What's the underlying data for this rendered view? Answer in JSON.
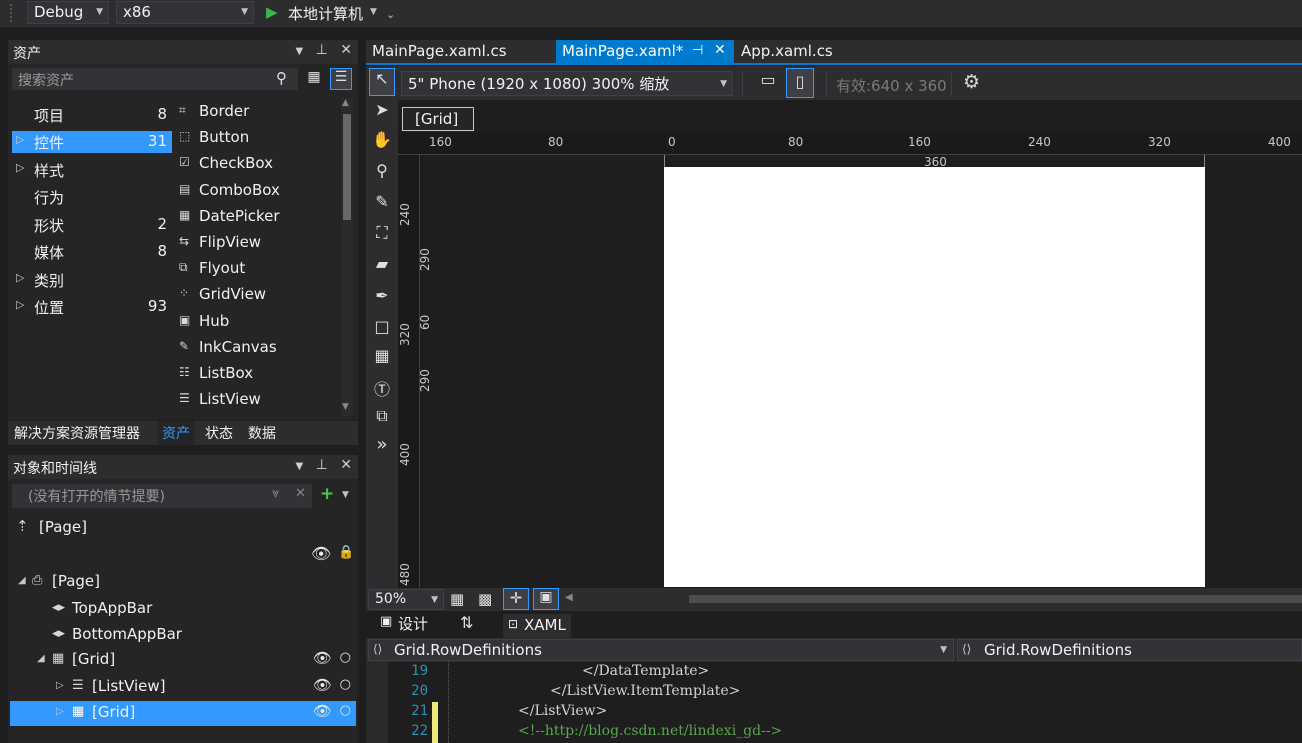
{
  "toolbar": {
    "config": "Debug",
    "platform": "x86",
    "run_target": "本地计算机"
  },
  "assets_panel": {
    "title": "资产",
    "search_placeholder": "搜索资产",
    "categories": [
      {
        "label": "项目",
        "count": "8",
        "expandable": false
      },
      {
        "label": "控件",
        "count": "31",
        "expandable": true
      },
      {
        "label": "样式",
        "count": "",
        "expandable": true
      },
      {
        "label": "行为",
        "count": "",
        "expandable": false
      },
      {
        "label": "形状",
        "count": "2",
        "expandable": false
      },
      {
        "label": "媒体",
        "count": "8",
        "expandable": false
      },
      {
        "label": "类别",
        "count": "",
        "expandable": true
      },
      {
        "label": "位置",
        "count": "93",
        "expandable": true
      }
    ],
    "controls": [
      {
        "label": "Border",
        "icon": "border-icon"
      },
      {
        "label": "Button",
        "icon": "button-icon"
      },
      {
        "label": "CheckBox",
        "icon": "checkbox-icon"
      },
      {
        "label": "ComboBox",
        "icon": "combobox-icon"
      },
      {
        "label": "DatePicker",
        "icon": "datepicker-icon"
      },
      {
        "label": "FlipView",
        "icon": "flipview-icon"
      },
      {
        "label": "Flyout",
        "icon": "flyout-icon"
      },
      {
        "label": "GridView",
        "icon": "gridview-icon"
      },
      {
        "label": "Hub",
        "icon": "hub-icon"
      },
      {
        "label": "InkCanvas",
        "icon": "inkcanvas-icon"
      },
      {
        "label": "ListBox",
        "icon": "listbox-icon"
      },
      {
        "label": "ListView",
        "icon": "listview-icon"
      }
    ],
    "bottom_tabs": [
      "解决方案资源管理器",
      "资产",
      "状态",
      "数据"
    ]
  },
  "objects_panel": {
    "title": "对象和时间线",
    "storyboard_placeholder": "(没有打开的情节提要)",
    "scope": "[Page]",
    "tree": [
      {
        "label": "[Page]"
      },
      {
        "label": "TopAppBar"
      },
      {
        "label": "BottomAppBar"
      },
      {
        "label": "[Grid]"
      },
      {
        "label": "[ListView]"
      },
      {
        "label": "[Grid]"
      }
    ]
  },
  "doc_tabs": [
    {
      "label": "MainPage.xaml.cs",
      "active": false
    },
    {
      "label": "MainPage.xaml*",
      "active": true
    },
    {
      "label": "App.xaml.cs",
      "active": false
    }
  ],
  "designer": {
    "device": "5\" Phone (1920 x 1080) 300% 缩放",
    "effective": "有效:640 x 360",
    "breadcrumb": "[Grid]",
    "zoom": "50%",
    "ruler_h": [
      "160",
      "80",
      "0",
      "80",
      "160",
      "240",
      "320",
      "400"
    ],
    "ruler_h_width": "360",
    "ruler_v": [
      "240",
      "290",
      "320",
      "60",
      "290",
      "400",
      "480"
    ],
    "view_tabs": {
      "design": "设计",
      "xaml": "XAML"
    }
  },
  "code_nav": {
    "left": "Grid.RowDefinitions",
    "right": "Grid.RowDefinitions"
  },
  "code_lines": [
    {
      "num": "19",
      "text": "</DataTemplate>",
      "indent": 190,
      "kind": "tag"
    },
    {
      "num": "20",
      "text": "</ListView.ItemTemplate>",
      "indent": 158,
      "kind": "tag"
    },
    {
      "num": "21",
      "text": "</ListView>",
      "indent": 126,
      "kind": "tag"
    },
    {
      "num": "22",
      "text": "<!--http://blog.csdn.net/lindexi_gd-->",
      "indent": 126,
      "kind": "comment"
    }
  ],
  "colors": {
    "accent": "#007acc",
    "selection": "#3399ff",
    "run_green": "#3bb54a",
    "add_green": "#4ec94e",
    "comment": "#57a64a",
    "tag": "#d4d4d4",
    "change_bar": "#f0e87a"
  }
}
